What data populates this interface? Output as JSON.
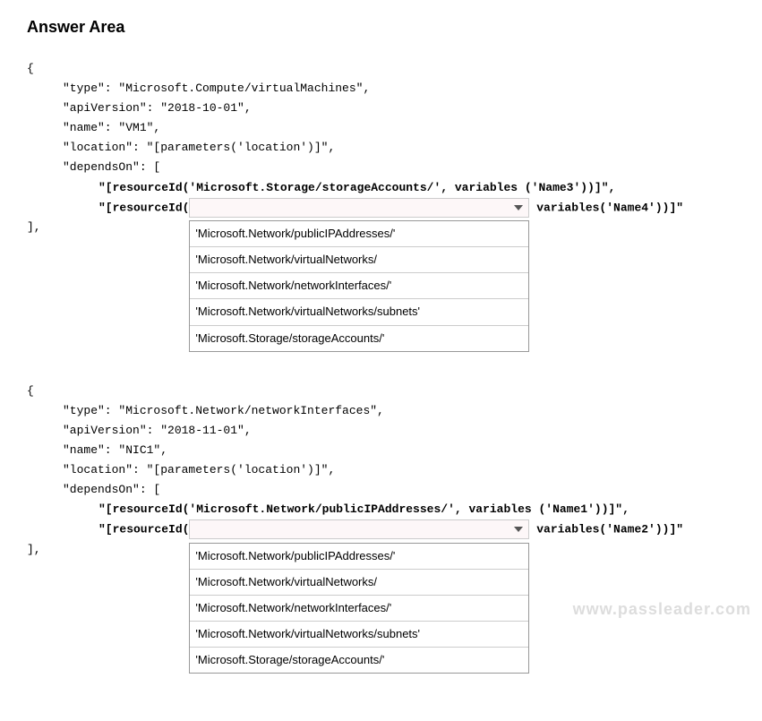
{
  "title": "Answer Area",
  "block1": {
    "open": "{",
    "type": "\"type\": \"Microsoft.Compute/virtualMachines\",",
    "api": "\"apiVersion\": \"2018-10-01\",",
    "name": "\"name\": \"VM1\",",
    "location": "\"location\": \"[parameters('location')]\",",
    "dependson": "\"dependsOn\": [",
    "dep1": "\"[resourceId('Microsoft.Storage/storageAccounts/', variables ('Name3'))]\",",
    "dep2_pre": "\"[resourceId(",
    "dep2_post": " variables('Name4'))]\"",
    "close": "],"
  },
  "block2": {
    "open": "{",
    "type": "\"type\": \"Microsoft.Network/networkInterfaces\",",
    "api": "\"apiVersion\": \"2018-11-01\",",
    "name": "\"name\": \"NIC1\",",
    "location": "\"location\": \"[parameters('location')]\",",
    "dependson": "\"dependsOn\": [",
    "dep1": "\"[resourceId('Microsoft.Network/publicIPAddresses/', variables ('Name1'))]\",",
    "dep2_pre": "\"[resourceId(",
    "dep2_post": " variables('Name2'))]\"",
    "close": "],"
  },
  "options": [
    "'Microsoft.Network/publicIPAddresses/'",
    "'Microsoft.Network/virtualNetworks/",
    "'Microsoft.Network/networkInterfaces/'",
    "'Microsoft.Network/virtualNetworks/subnets'",
    "'Microsoft.Storage/storageAccounts/'"
  ],
  "watermark": "www.passleader.com"
}
